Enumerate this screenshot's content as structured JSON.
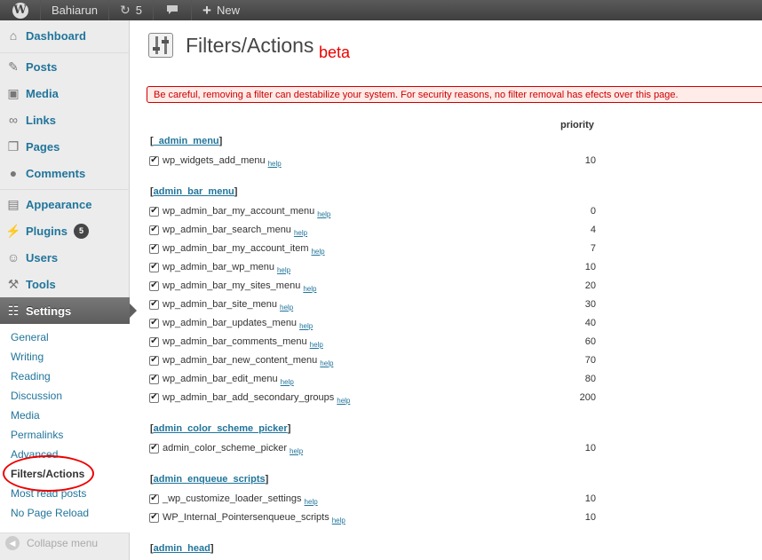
{
  "adminbar": {
    "site_name": "Bahiarun",
    "updates_count": "5",
    "new_label": "New"
  },
  "sidebar": {
    "items": [
      {
        "label": "Dashboard",
        "icon": "dashboard-icon"
      },
      {
        "label": "Posts",
        "icon": "pin-icon"
      },
      {
        "label": "Media",
        "icon": "media-icon"
      },
      {
        "label": "Links",
        "icon": "link-icon"
      },
      {
        "label": "Pages",
        "icon": "pages-icon"
      },
      {
        "label": "Comments",
        "icon": "comment-icon"
      },
      {
        "label": "Appearance",
        "icon": "appearance-icon"
      },
      {
        "label": "Plugins",
        "icon": "plugin-icon",
        "badge": "5"
      },
      {
        "label": "Users",
        "icon": "users-icon"
      },
      {
        "label": "Tools",
        "icon": "tools-icon"
      },
      {
        "label": "Settings",
        "icon": "settings-icon"
      }
    ],
    "submenu": [
      "General",
      "Writing",
      "Reading",
      "Discussion",
      "Media",
      "Permalinks",
      "Advanced",
      "Filters/Actions",
      "Most read posts",
      "No Page Reload"
    ],
    "collapse_label": "Collapse menu"
  },
  "page": {
    "title": "Filters/Actions",
    "beta": "beta",
    "warning": "Be careful, removing a filter can destabilize your system. For security reasons, no filter removal has efects over this page.",
    "priority_header": "priority",
    "help_label": "help"
  },
  "hooks": [
    {
      "name": "_admin_menu",
      "filters": [
        {
          "name": "wp_widgets_add_menu",
          "priority": "10"
        }
      ]
    },
    {
      "name": "admin_bar_menu",
      "filters": [
        {
          "name": "wp_admin_bar_my_account_menu",
          "priority": "0"
        },
        {
          "name": "wp_admin_bar_search_menu",
          "priority": "4"
        },
        {
          "name": "wp_admin_bar_my_account_item",
          "priority": "7"
        },
        {
          "name": "wp_admin_bar_wp_menu",
          "priority": "10"
        },
        {
          "name": "wp_admin_bar_my_sites_menu",
          "priority": "20"
        },
        {
          "name": "wp_admin_bar_site_menu",
          "priority": "30"
        },
        {
          "name": "wp_admin_bar_updates_menu",
          "priority": "40"
        },
        {
          "name": "wp_admin_bar_comments_menu",
          "priority": "60"
        },
        {
          "name": "wp_admin_bar_new_content_menu",
          "priority": "70"
        },
        {
          "name": "wp_admin_bar_edit_menu",
          "priority": "80"
        },
        {
          "name": "wp_admin_bar_add_secondary_groups",
          "priority": "200"
        }
      ]
    },
    {
      "name": "admin_color_scheme_picker",
      "filters": [
        {
          "name": "admin_color_scheme_picker",
          "priority": "10"
        }
      ]
    },
    {
      "name": "admin_enqueue_scripts",
      "filters": [
        {
          "name": "_wp_customize_loader_settings",
          "priority": "10"
        },
        {
          "name": "WP_Internal_Pointersenqueue_scripts",
          "priority": "10"
        }
      ]
    },
    {
      "name": "admin_head",
      "filters": []
    }
  ]
}
